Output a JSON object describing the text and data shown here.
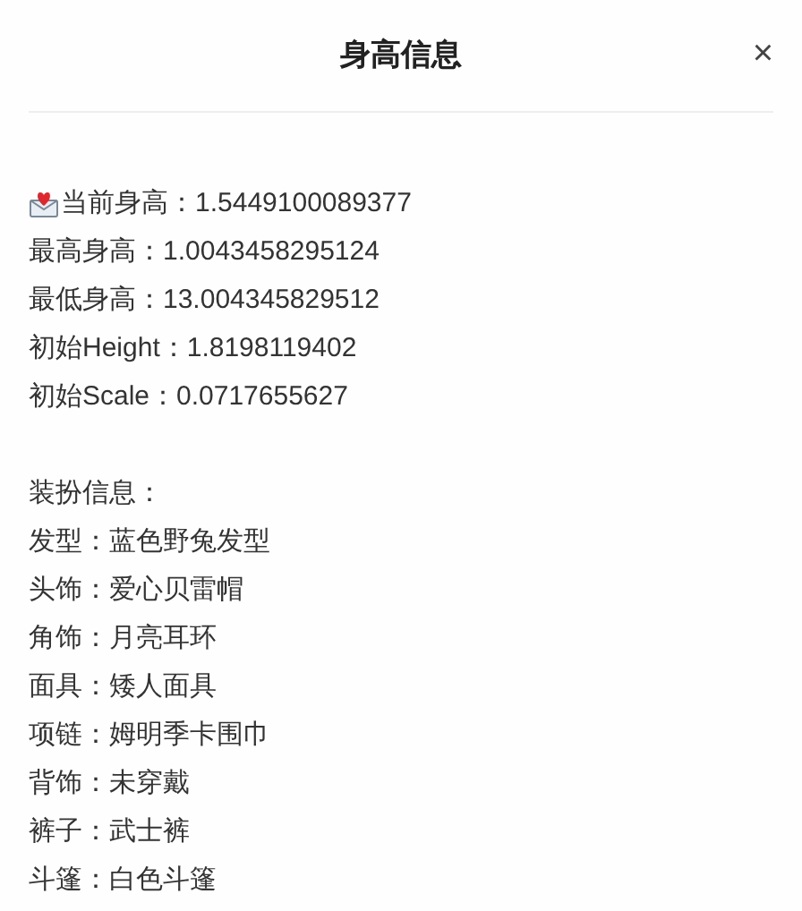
{
  "dialog": {
    "title": "身高信息",
    "close": "×"
  },
  "height_lines": [
    {
      "kind": "mail",
      "text": "当前身高：1.5449100089377"
    },
    {
      "kind": "plain",
      "text": "最高身高：1.0043458295124"
    },
    {
      "kind": "plain",
      "text": "最低身高：13.004345829512"
    },
    {
      "kind": "plain",
      "text": "初始Height：1.8198119402"
    },
    {
      "kind": "plain",
      "text": "初始Scale：0.0717655627"
    }
  ],
  "outfit": {
    "heading": "装扮信息：",
    "lines": [
      "发型：蓝色野兔发型",
      "头饰：爱心贝雷帽",
      "角饰：月亮耳环",
      "面具：矮人面具",
      "项链：姆明季卡围巾",
      "背饰：未穿戴",
      "裤子：武士裤",
      "斗篷：白色斗篷"
    ]
  }
}
